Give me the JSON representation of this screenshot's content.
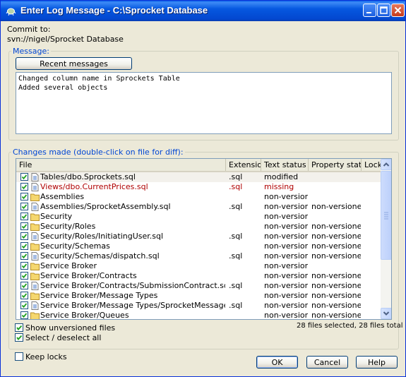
{
  "window": {
    "title": "Enter Log Message - C:\\Sprocket Database"
  },
  "commit": {
    "label": "Commit to:",
    "url": "svn://nigel/Sprocket Database"
  },
  "message": {
    "group_label": "Message:",
    "recent_button": "Recent messages",
    "text": "Changed column name in Sprockets Table\nAdded several objects"
  },
  "changes": {
    "group_label": "Changes made (double-click on file for diff):",
    "columns": [
      "File",
      "Extension",
      "Text status",
      "Property status",
      "Lock"
    ],
    "rows": [
      {
        "file": "Tables/dbo.Sprockets.sql",
        "ext": ".sql",
        "text_status": "modified",
        "prop_status": "",
        "icon": "file-icon",
        "missing": false
      },
      {
        "file": "Views/dbo.CurrentPrices.sql",
        "ext": ".sql",
        "text_status": "missing",
        "prop_status": "",
        "icon": "file-icon",
        "missing": true
      },
      {
        "file": "Assemblies",
        "ext": "",
        "text_status": "non-versioned",
        "prop_status": "",
        "icon": "folder-icon",
        "missing": false
      },
      {
        "file": "Assemblies/SprocketAssembly.sql",
        "ext": ".sql",
        "text_status": "non-versioned",
        "prop_status": "non-versioned",
        "icon": "file-icon",
        "missing": false
      },
      {
        "file": "Security",
        "ext": "",
        "text_status": "non-versioned",
        "prop_status": "",
        "icon": "folder-icon",
        "missing": false
      },
      {
        "file": "Security/Roles",
        "ext": "",
        "text_status": "non-versioned",
        "prop_status": "non-versioned",
        "icon": "folder-icon",
        "missing": false
      },
      {
        "file": "Security/Roles/InitiatingUser.sql",
        "ext": ".sql",
        "text_status": "non-versioned",
        "prop_status": "non-versioned",
        "icon": "file-icon",
        "missing": false
      },
      {
        "file": "Security/Schemas",
        "ext": "",
        "text_status": "non-versioned",
        "prop_status": "non-versioned",
        "icon": "folder-icon",
        "missing": false
      },
      {
        "file": "Security/Schemas/dispatch.sql",
        "ext": ".sql",
        "text_status": "non-versioned",
        "prop_status": "non-versioned",
        "icon": "file-icon",
        "missing": false
      },
      {
        "file": "Service Broker",
        "ext": "",
        "text_status": "non-versioned",
        "prop_status": "",
        "icon": "folder-icon",
        "missing": false
      },
      {
        "file": "Service Broker/Contracts",
        "ext": "",
        "text_status": "non-versioned",
        "prop_status": "non-versioned",
        "icon": "folder-icon",
        "missing": false
      },
      {
        "file": "Service Broker/Contracts/SubmissionContract.sql",
        "ext": ".sql",
        "text_status": "non-versioned",
        "prop_status": "non-versioned",
        "icon": "file-icon",
        "missing": false
      },
      {
        "file": "Service Broker/Message Types",
        "ext": "",
        "text_status": "non-versioned",
        "prop_status": "non-versioned",
        "icon": "folder-icon",
        "missing": false
      },
      {
        "file": "Service Broker/Message Types/SprocketMessage.sql",
        "ext": ".sql",
        "text_status": "non-versioned",
        "prop_status": "non-versioned",
        "icon": "file-icon",
        "missing": false
      },
      {
        "file": "Service Broker/Queues",
        "ext": "",
        "text_status": "non-versioned",
        "prop_status": "non-versioned",
        "icon": "folder-icon",
        "missing": false
      }
    ],
    "show_unversioned": "Show unversioned files",
    "select_all": "Select / deselect all",
    "summary": "28 files selected, 28 files total"
  },
  "keep_locks": "Keep locks",
  "buttons": {
    "ok": "OK",
    "cancel": "Cancel",
    "help": "Help"
  },
  "colors": {
    "title_bar": "#0658e0",
    "group_label": "#0046d5",
    "missing_text": "#b00000",
    "folder": "#f5d76e"
  }
}
